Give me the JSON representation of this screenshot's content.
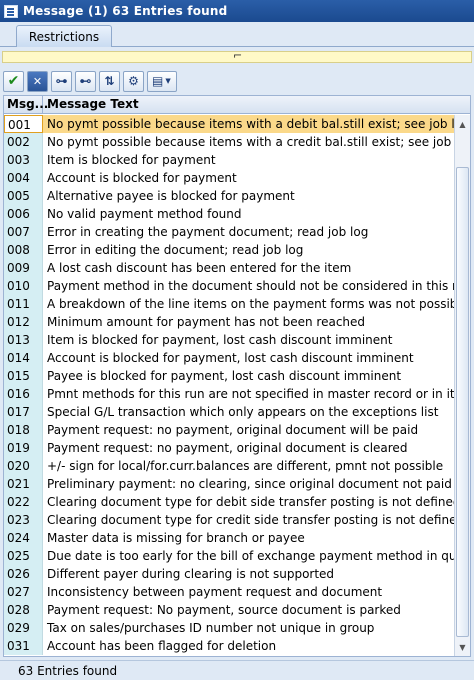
{
  "window": {
    "title": "Message (1)   63 Entries found"
  },
  "tabs": [
    {
      "label": "Restrictions"
    }
  ],
  "infobar": {
    "marker": "⌐"
  },
  "table": {
    "headers": [
      "Msg...",
      "Message Text"
    ],
    "rows": [
      [
        "001",
        "No pymt possible because items with a debit bal.still exist; see job log"
      ],
      [
        "002",
        "No pymt possible because items with a credit bal.still exist; see job log"
      ],
      [
        "003",
        "Item is blocked for payment"
      ],
      [
        "004",
        "Account is blocked for payment"
      ],
      [
        "005",
        "Alternative payee is blocked for payment"
      ],
      [
        "006",
        "No valid payment method found"
      ],
      [
        "007",
        "Error in creating the payment document; read job log"
      ],
      [
        "008",
        "Error in editing the document; read job log"
      ],
      [
        "009",
        "A lost cash discount has been entered for the item"
      ],
      [
        "010",
        "Payment method in the document should not be considered in this run"
      ],
      [
        "011",
        "A breakdown of the line items on the payment forms was not possible"
      ],
      [
        "012",
        "Minimum amount for payment has not been reached"
      ],
      [
        "013",
        "Item is blocked for payment, lost cash discount imminent"
      ],
      [
        "014",
        "Account is blocked for payment, lost cash discount imminent"
      ],
      [
        "015",
        "Payee is blocked for payment, lost cash discount imminent"
      ],
      [
        "016",
        "Pmnt methods for this run are not specified in master record or in item"
      ],
      [
        "017",
        "Special G/L transaction which only appears on the exceptions list"
      ],
      [
        "018",
        "Payment request: no payment, original document will be paid"
      ],
      [
        "019",
        "Payment request: no payment, original document is cleared"
      ],
      [
        "020",
        "+/- sign for local/for.curr.balances are different, pmnt not possible"
      ],
      [
        "021",
        "Preliminary payment: no clearing, since original document not paid"
      ],
      [
        "022",
        "Clearing document type for debit side transfer posting is not defined"
      ],
      [
        "023",
        "Clearing document type for credit side transfer posting is not defined"
      ],
      [
        "024",
        "Master data is missing for branch or payee"
      ],
      [
        "025",
        "Due date is too early for the bill of exchange payment method in question"
      ],
      [
        "026",
        "Different payer during clearing is not supported"
      ],
      [
        "027",
        "Inconsistency between payment request and document"
      ],
      [
        "028",
        "Payment request: No payment, source document is parked"
      ],
      [
        "029",
        "Tax on sales/purchases ID number not unique in group"
      ],
      [
        "031",
        "Account has been flagged for deletion"
      ]
    ],
    "selected_row": 0
  },
  "status": {
    "text": "63 Entries found"
  },
  "icons": {
    "accept": "check-icon",
    "cancel": "cancel-icon",
    "find": "binoculars-icon",
    "find_next": "binoculars-next-icon",
    "sort": "sort-icon",
    "settings": "settings-icon",
    "print": "print-icon"
  },
  "colors": {
    "title_bg": "#1b4a8f",
    "selected_row": "#fbd98a",
    "key_column": "#d5eef3",
    "info_bar": "#fff9c7"
  }
}
